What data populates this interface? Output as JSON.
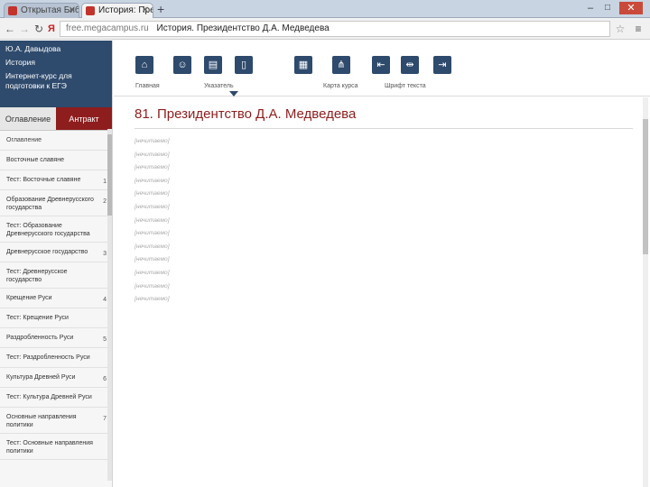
{
  "browser": {
    "tabs": [
      {
        "label": "Открытая Библ",
        "active": false
      },
      {
        "label": "История: Презид",
        "active": true
      }
    ],
    "new_tab_label": "+",
    "window_controls": {
      "minimize": "–",
      "maximize": "□",
      "close": "✕"
    },
    "nav": {
      "back": "←",
      "forward": "→",
      "reload": "↻",
      "yandex": "Я"
    },
    "url_host": "free.megacampus.ru",
    "url_title": "История. Президентство Д.А. Медведева",
    "star": "☆",
    "menu": "≡"
  },
  "sidebar": {
    "top_links": [
      "Ю.А. Давыдова",
      "История",
      "Интернет-курс для подготовки к ЕГЭ"
    ],
    "tabs": {
      "left": "Оглавление",
      "right": "Антракт"
    },
    "items": [
      {
        "label": "Оглавление",
        "num": "",
        "head": true
      },
      {
        "label": "Восточные славяне",
        "num": ""
      },
      {
        "label": "Тест: Восточные славяне",
        "num": "1"
      },
      {
        "label": "Образование Древнерусского государства",
        "num": "2"
      },
      {
        "label": "Тест: Образование Древнерусского государства",
        "num": ""
      },
      {
        "label": "Древнерусское государство",
        "num": "3"
      },
      {
        "label": "Тест: Древнерусское государство",
        "num": ""
      },
      {
        "label": "Крещение Руси",
        "num": "4"
      },
      {
        "label": "Тест: Крещение Руси",
        "num": ""
      },
      {
        "label": "Раздробленность Руси",
        "num": "5"
      },
      {
        "label": "Тест: Раздробленность Руси",
        "num": ""
      },
      {
        "label": "Культура Древней Руси",
        "num": "6"
      },
      {
        "label": "Тест: Культура Древней Руси",
        "num": ""
      },
      {
        "label": "Основные направления политики",
        "num": "7"
      },
      {
        "label": "Тест: Основные направления политики",
        "num": ""
      }
    ]
  },
  "toolbar": {
    "buttons": [
      {
        "icon": "home-icon",
        "glyph": "⌂",
        "label": "Главная"
      },
      {
        "icon": "users-icon",
        "glyph": "☺",
        "label": ""
      },
      {
        "icon": "book-icon",
        "glyph": "▤",
        "label": "Указатель"
      },
      {
        "icon": "bookmark-icon",
        "glyph": "▯",
        "label": ""
      },
      {
        "icon": "calendar-icon",
        "glyph": "▦",
        "label": ""
      },
      {
        "icon": "sitemap-icon",
        "glyph": "⋔",
        "label": "Карта курса"
      },
      {
        "icon": "collapse-icon",
        "glyph": "⇤",
        "label": ""
      },
      {
        "icon": "text-size-icon",
        "glyph": "⇹",
        "label": "Шрифт текста"
      },
      {
        "icon": "expand-icon",
        "glyph": "⇥",
        "label": ""
      }
    ]
  },
  "document": {
    "title": "81. Президентство Д.А. Медведева",
    "paragraphs": [
      "[нечитаемо]",
      "[нечитаемо]",
      "[нечитаемо]",
      "[нечитаемо]",
      "[нечитаемо]",
      "[нечитаемо]",
      "[нечитаемо]",
      "[нечитаемо]",
      "[нечитаемо]",
      "[нечитаемо]",
      "[нечитаемо]",
      "[нечитаемо]",
      "[нечитаемо]"
    ]
  }
}
